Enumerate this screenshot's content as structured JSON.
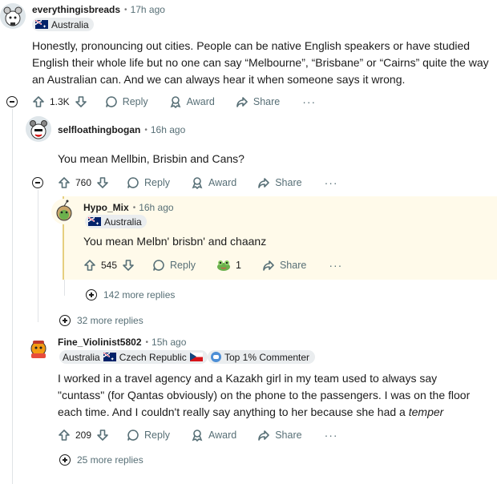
{
  "comments": [
    {
      "username": "everythingisbreads",
      "time": "17h ago",
      "flair": "Australia",
      "body": "Honestly, pronouncing out cities. People can be native English speakers or have studied English their whole life but no one can say “Melbourne”, “Brisbane” or “Cairns” quite the way an Australian can. And we can always hear it when someone says it wrong.",
      "votes": "1.3K",
      "reply_label": "Reply",
      "award_label": "Award",
      "share_label": "Share",
      "more_label": "···"
    },
    {
      "username": "selfloathingbogan",
      "time": "16h ago",
      "body": "You mean Mellbin, Brisbin and Cans?",
      "votes": "760",
      "reply_label": "Reply",
      "award_label": "Award",
      "share_label": "Share",
      "more_label": "···"
    },
    {
      "username": "Hypo_Mix",
      "time": "16h ago",
      "flair": "Australia",
      "body": "You mean Melbn' brisbn' and chaanz",
      "votes": "545",
      "reply_label": "Reply",
      "award_count": "1",
      "share_label": "Share",
      "more_label": "···",
      "more_replies": "142 more replies"
    },
    {
      "more_replies": "32 more replies"
    },
    {
      "username": "Fine_Violinist5802",
      "time": "15h ago",
      "flair_1": "Australia",
      "flair_2": "Czech Republic",
      "badge": "Top 1% Commenter",
      "body_plain": "I worked in a travel agency and a Kazakh girl in my team used to always say \"cuntass\" (for Qantas obviously) on the phone to the passengers. I was on the floor each time. And I couldn't really say anything to her because she had a ",
      "body_italic": "temper",
      "votes": "209",
      "reply_label": "Reply",
      "award_label": "Award",
      "share_label": "Share",
      "more_label": "···",
      "more_replies": "25 more replies"
    }
  ],
  "colors": {
    "text": "#1c1c1c",
    "muted": "#576f76",
    "highlight_bg": "#fffaea",
    "flair_bg": "#eaedef"
  }
}
